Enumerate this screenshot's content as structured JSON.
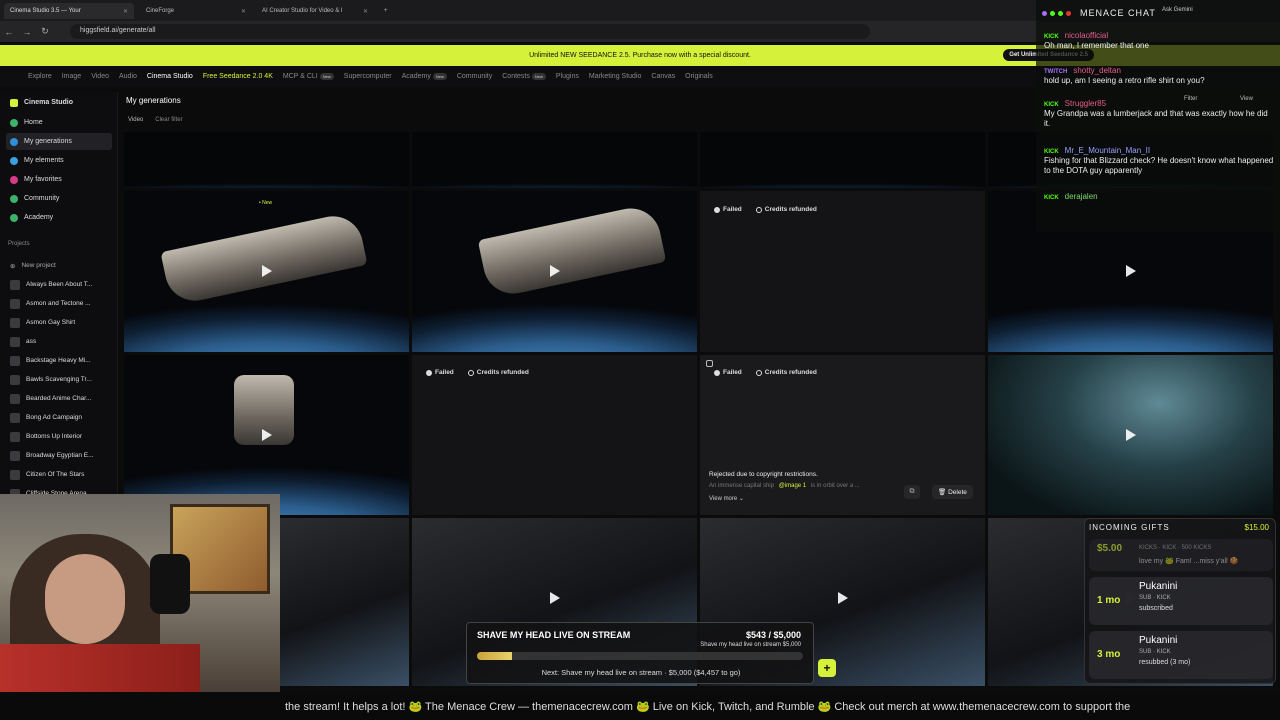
{
  "browser": {
    "tabs": [
      {
        "label": "Cinema Studio 3.5 — Your",
        "active": true
      },
      {
        "label": "CineForge",
        "active": false
      },
      {
        "label": "AI Creator Studio for Video & I",
        "active": false
      }
    ],
    "url": "higgsfield.ai/generate/all",
    "ask_gemini": "Ask Gemini"
  },
  "promo": {
    "text": "Unlimited NEW SEEDANCE 2.5. Purchase now with a special discount.",
    "button": "Get Unlimited Seedance 2.5"
  },
  "topnav": {
    "items": [
      "Explore",
      "Image",
      "Video",
      "Audio",
      "Cinema Studio",
      "Free Seedance 2.0 4K",
      "MCP & CLI",
      "Supercomputer",
      "Academy",
      "Community",
      "Contests",
      "Plugins",
      "Marketing Studio",
      "Canvas",
      "Originals"
    ],
    "new_badge": "New"
  },
  "sidebar": {
    "title": "Cinema Studio",
    "items": [
      {
        "label": "Home"
      },
      {
        "label": "My generations"
      },
      {
        "label": "My elements"
      },
      {
        "label": "My favorites"
      },
      {
        "label": "Community"
      },
      {
        "label": "Academy"
      }
    ],
    "projects_label": "Projects",
    "new_project": "New project",
    "projects": [
      "Always Been About T...",
      "Asmon and Tectone ...",
      "Asmon Gay Shirt",
      "ass",
      "Backstage Heavy Mi...",
      "Bawls Scavenging Tr...",
      "Bearded Anime Char...",
      "Bong Ad Campaign",
      "Bottoms Up Interior",
      "Broadway Egyptian E...",
      "Citizen Of The Stars",
      "Cliffside Stone Arena"
    ]
  },
  "main": {
    "title": "My generations",
    "filter_video": "Video",
    "filter_clear": "Clear filter",
    "filter_btn": "Filter",
    "view_btn": "View",
    "new_tag": "• New",
    "failed": "Failed",
    "refunded": "Credits refunded",
    "rejected": "Rejected due to copyright restrictions.",
    "prompt_snippet": "An immense capital ship",
    "prompt_tag": "@image 1",
    "prompt_rest": "is in orbit over a ...",
    "view_more": "View more",
    "delete": "Delete"
  },
  "chat": {
    "title": "MENACE CHAT",
    "messages": [
      {
        "platform": "KICK",
        "user": "nicolaofficial",
        "text": "Oh man, I remember that one"
      },
      {
        "platform": "TWITCH",
        "user": "shotty_deltan",
        "text": "hold up, am I seeing a retro rifle shirt on you?"
      },
      {
        "platform": "KICK",
        "user": "Struggler85",
        "text": "My Grandpa was a lumberjack and that was exactly how he did it."
      },
      {
        "platform": "KICK",
        "user": "Mr_E_Mountain_Man_II",
        "text": "Fishing for that Blizzard check? He doesn't know what happened to the DOTA guy apparently"
      },
      {
        "platform": "KICK",
        "user": "derajalen",
        "text": ""
      }
    ]
  },
  "gifts": {
    "title": "INCOMING GIFTS",
    "total": "$15.00",
    "items": [
      {
        "amount": "$5.00",
        "name": "",
        "sub": "KICKS · KICK · 500 KICKS",
        "status": "love my 🐸 Fam! ...miss y'all 🍪"
      },
      {
        "amount": "1 mo",
        "name": "Pukanini",
        "sub": "SUB · KICK",
        "status": "subscribed"
      },
      {
        "amount": "3 mo",
        "name": "Pukanini",
        "sub": "SUB · KICK",
        "status": "resubbed (3 mo)"
      }
    ]
  },
  "goal": {
    "title": "SHAVE MY HEAD LIVE ON STREAM",
    "amount": "$543 / $5,000",
    "subtitle": "Shave my head live on stream $5,000",
    "progress": 0.1086,
    "next": "Next: Shave my head live on stream · $5,000 ($4,457 to go)",
    "plus": "+"
  },
  "ticker": {
    "text": "the stream! It helps a lot!    🐸 The Menace Crew — themenacecrew.com    🐸 Live on Kick, Twitch, and Rumble    🐸 Check out merch at www.themenacecrew.com to support the"
  },
  "colors": {
    "accent": "#d6f13a",
    "kick": "#53fc18",
    "twitch": "#a970ff"
  }
}
